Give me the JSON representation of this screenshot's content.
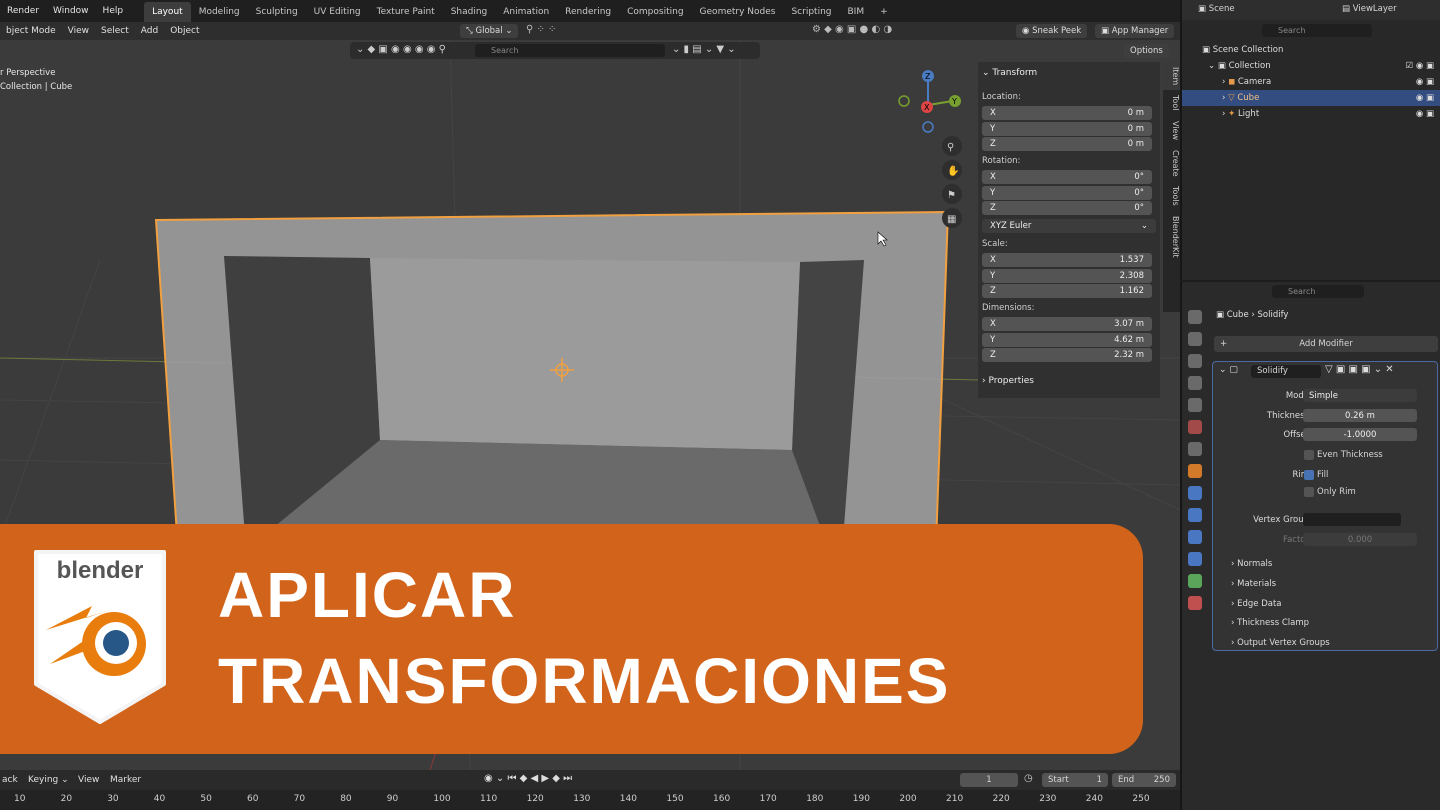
{
  "topmenu": [
    "Render",
    "Window",
    "Help"
  ],
  "workspaces": [
    "Layout",
    "Modeling",
    "Sculpting",
    "UV Editing",
    "Texture Paint",
    "Shading",
    "Animation",
    "Rendering",
    "Compositing",
    "Geometry Nodes",
    "Scripting",
    "BIM",
    "+"
  ],
  "header": {
    "mode": "bject Mode",
    "menus": [
      "View",
      "Select",
      "Add",
      "Object"
    ],
    "orientation": "Global",
    "sneak_peek": "Sneak Peek",
    "app_manager": "App Manager",
    "options": "Options",
    "search_placeholder": "Search"
  },
  "viewport": {
    "line1": "r Perspective",
    "line2": "Collection | Cube"
  },
  "npanel": {
    "title": "Transform",
    "location_label": "Location:",
    "location": [
      [
        "X",
        "0 m"
      ],
      [
        "Y",
        "0 m"
      ],
      [
        "Z",
        "0 m"
      ]
    ],
    "rotation_label": "Rotation:",
    "rotation": [
      [
        "X",
        "0°"
      ],
      [
        "Y",
        "0°"
      ],
      [
        "Z",
        "0°"
      ]
    ],
    "rotation_mode": "XYZ Euler",
    "scale_label": "Scale:",
    "scale": [
      [
        "X",
        "1.537"
      ],
      [
        "Y",
        "2.308"
      ],
      [
        "Z",
        "1.162"
      ]
    ],
    "dimensions_label": "Dimensions:",
    "dimensions": [
      [
        "X",
        "3.07 m"
      ],
      [
        "Y",
        "4.62 m"
      ],
      [
        "Z",
        "2.32 m"
      ]
    ],
    "properties": "Properties"
  },
  "sidetabs": [
    "Item",
    "Tool",
    "View",
    "Create",
    "Tools",
    "BlenderKit"
  ],
  "outliner": {
    "scene": "Scene",
    "viewlayer": "ViewLayer",
    "search": "Search",
    "rows": [
      "Scene Collection",
      "Collection",
      "Camera",
      "Cube",
      "Light"
    ]
  },
  "properties": {
    "search": "Search",
    "breadcrumb_obj": "Cube",
    "breadcrumb_mod": "Solidify",
    "add_modifier": "Add Modifier",
    "modifier_name": "Solidify",
    "mode_label": "Mode",
    "mode_value": "Simple",
    "thickness_label": "Thickness",
    "thickness_value": "0.26 m",
    "offset_label": "Offset",
    "offset_value": "-1.0000",
    "even_thickness": "Even Thickness",
    "rim_label": "Rim",
    "fill": "Fill",
    "only_rim": "Only Rim",
    "vertex_group_label": "Vertex Group",
    "factor_label": "Factor",
    "factor_value": "0.000",
    "subpanels": [
      "Normals",
      "Materials",
      "Edge Data",
      "Thickness Clamp",
      "Output Vertex Groups"
    ]
  },
  "timeline": {
    "playback": "ack",
    "keying": "Keying",
    "view": "View",
    "marker": "Marker",
    "current_frame": "1",
    "start_label": "Start",
    "start": "1",
    "end_label": "End",
    "end": "250",
    "ticks": [
      "10",
      "20",
      "30",
      "40",
      "50",
      "60",
      "70",
      "80",
      "90",
      "100",
      "110",
      "120",
      "130",
      "140",
      "150",
      "160",
      "170",
      "180",
      "190",
      "200",
      "210",
      "220",
      "230",
      "240",
      "250"
    ]
  },
  "banner": {
    "logo_text": "blender",
    "line1": "APLICAR",
    "line2": "TRANSFORMACIONES"
  },
  "colors": {
    "banner": "#d2631a",
    "select_outline": "#f0a040",
    "active_row": "#334d80"
  }
}
